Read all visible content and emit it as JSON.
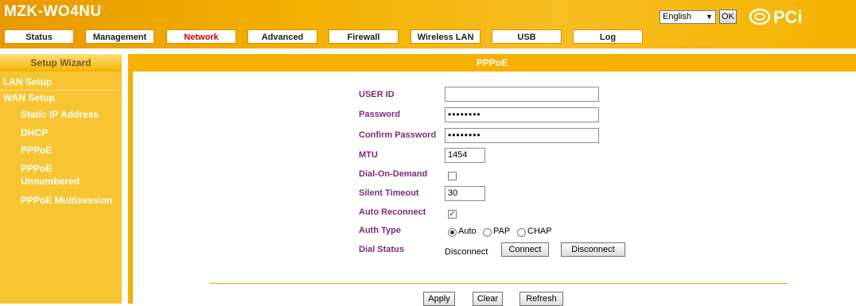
{
  "header": {
    "brand": "MZK-WO4NU",
    "language": "English",
    "ok_label": "OK",
    "logo_text": "PCi"
  },
  "nav": {
    "tabs": [
      {
        "label": "Status"
      },
      {
        "label": "Management"
      },
      {
        "label": "Network"
      },
      {
        "label": "Advanced"
      },
      {
        "label": "Firewall"
      },
      {
        "label": "Wireless LAN"
      },
      {
        "label": "USB"
      },
      {
        "label": "Log"
      }
    ],
    "active": "Network"
  },
  "sidebar": {
    "wizard": "Setup Wizard",
    "items": [
      {
        "label": "LAN Setup"
      },
      {
        "label": "WAN Setup"
      },
      {
        "label": "Static IP Address"
      },
      {
        "label": "DHCP"
      },
      {
        "label": "PPPoE"
      },
      {
        "label": "PPPoE"
      },
      {
        "label": "Unnumbered"
      },
      {
        "label": "PPPoE Multisession"
      }
    ]
  },
  "form": {
    "title": "PPPoE",
    "user_id": {
      "label": "USER ID",
      "value": ""
    },
    "password": {
      "label": "Password",
      "value": "••••••••"
    },
    "confirm_password": {
      "label": "Confirm Password",
      "value": "••••••••"
    },
    "mtu": {
      "label": "MTU",
      "value": "1454"
    },
    "dial_on_demand": {
      "label": "Dial-On-Demand",
      "checked": false
    },
    "silent_timeout": {
      "label": "Silent Timeout",
      "value": "30"
    },
    "auto_reconnect": {
      "label": "Auto Reconnect",
      "checked": true
    },
    "auth_type": {
      "label": "Auth Type",
      "options": [
        "Auto",
        "PAP",
        "CHAP"
      ],
      "selected": "Auto"
    },
    "dial_status": {
      "label": "Dial Status",
      "value": "Disconnect",
      "connect_label": "Connect",
      "disconnect_label": "Disconnect"
    },
    "apply_label": "Apply",
    "clear_label": "Clear",
    "refresh_label": "Refresh"
  },
  "colors": {
    "header_orange": "#f3b000",
    "sidebar_yellow": "#f7c531",
    "label_purple": "#7b2c7b",
    "active_tab_red": "#d40000"
  }
}
